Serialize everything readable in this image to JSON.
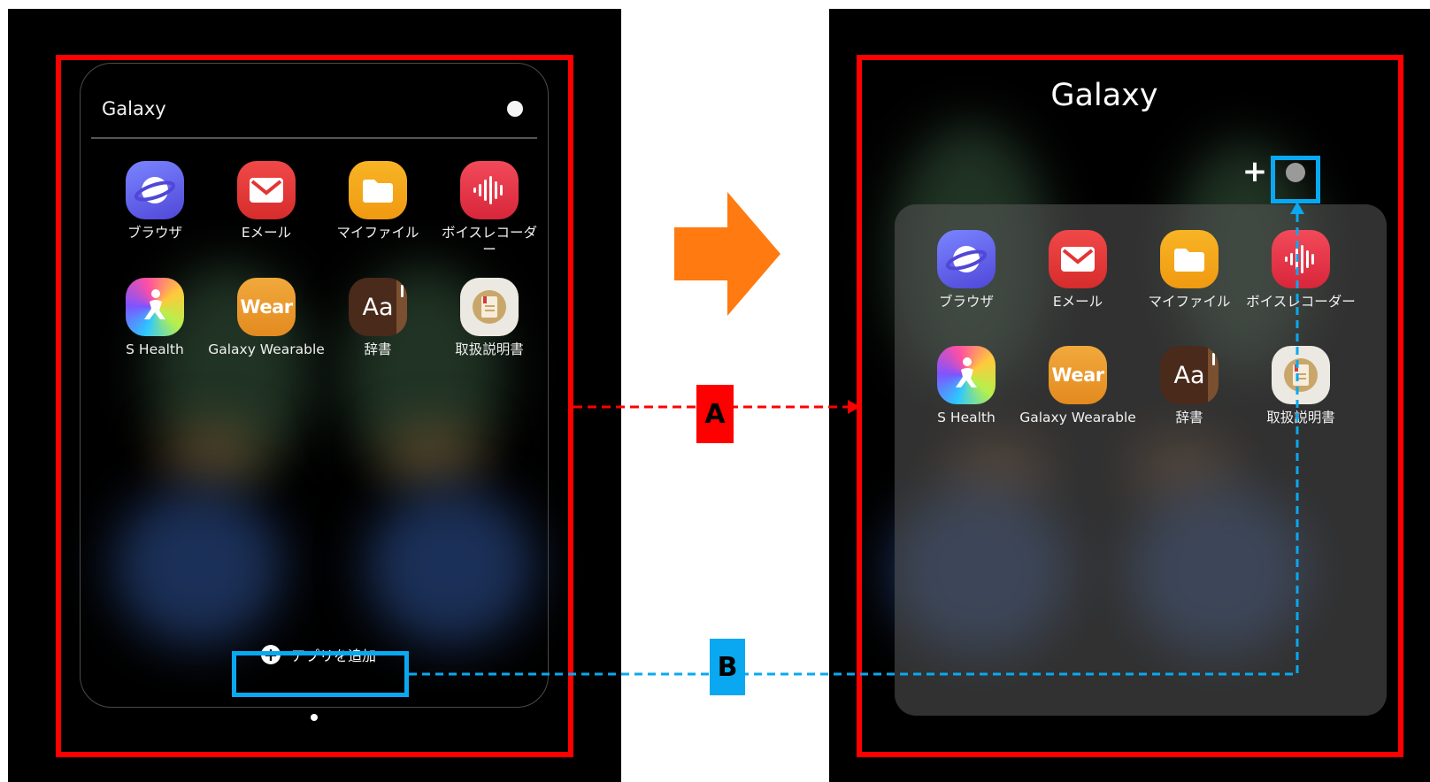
{
  "left_screen": {
    "folder_title": "Galaxy",
    "apps": [
      {
        "label": "ブラウザ",
        "icon": "browser-icon"
      },
      {
        "label": "Eメール",
        "icon": "email-icon"
      },
      {
        "label": "マイファイル",
        "icon": "folder-icon"
      },
      {
        "label": "ボイスレコーダー",
        "icon": "voice-recorder-icon"
      },
      {
        "label": "S Health",
        "icon": "s-health-icon"
      },
      {
        "label": "Galaxy Wearable",
        "icon": "galaxy-wearable-icon"
      },
      {
        "label": "辞書",
        "icon": "dictionary-icon"
      },
      {
        "label": "取扱説明書",
        "icon": "manual-icon"
      }
    ],
    "add_button_label": "アプリを追加",
    "add_button_icon": "plus-circle-icon",
    "wear_icon_text": "Wear",
    "dict_icon_text": "Aa"
  },
  "right_screen": {
    "folder_title": "Galaxy",
    "add_icon": "plus-icon",
    "apps": [
      {
        "label": "ブラウザ",
        "icon": "browser-icon"
      },
      {
        "label": "Eメール",
        "icon": "email-icon"
      },
      {
        "label": "マイファイル",
        "icon": "folder-icon"
      },
      {
        "label": "ボイスレコーダー",
        "icon": "voice-recorder-icon"
      },
      {
        "label": "S Health",
        "icon": "s-health-icon"
      },
      {
        "label": "Galaxy Wearable",
        "icon": "galaxy-wearable-icon"
      },
      {
        "label": "辞書",
        "icon": "dictionary-icon"
      },
      {
        "label": "取扱説明書",
        "icon": "manual-icon"
      }
    ],
    "wear_icon_text": "Wear",
    "dict_icon_text": "Aa"
  },
  "annotations": {
    "badge_a": "A",
    "badge_b": "B",
    "color_red": "#ff0000",
    "color_blue": "#0aa8f0",
    "color_orange": "#ff7a10"
  }
}
